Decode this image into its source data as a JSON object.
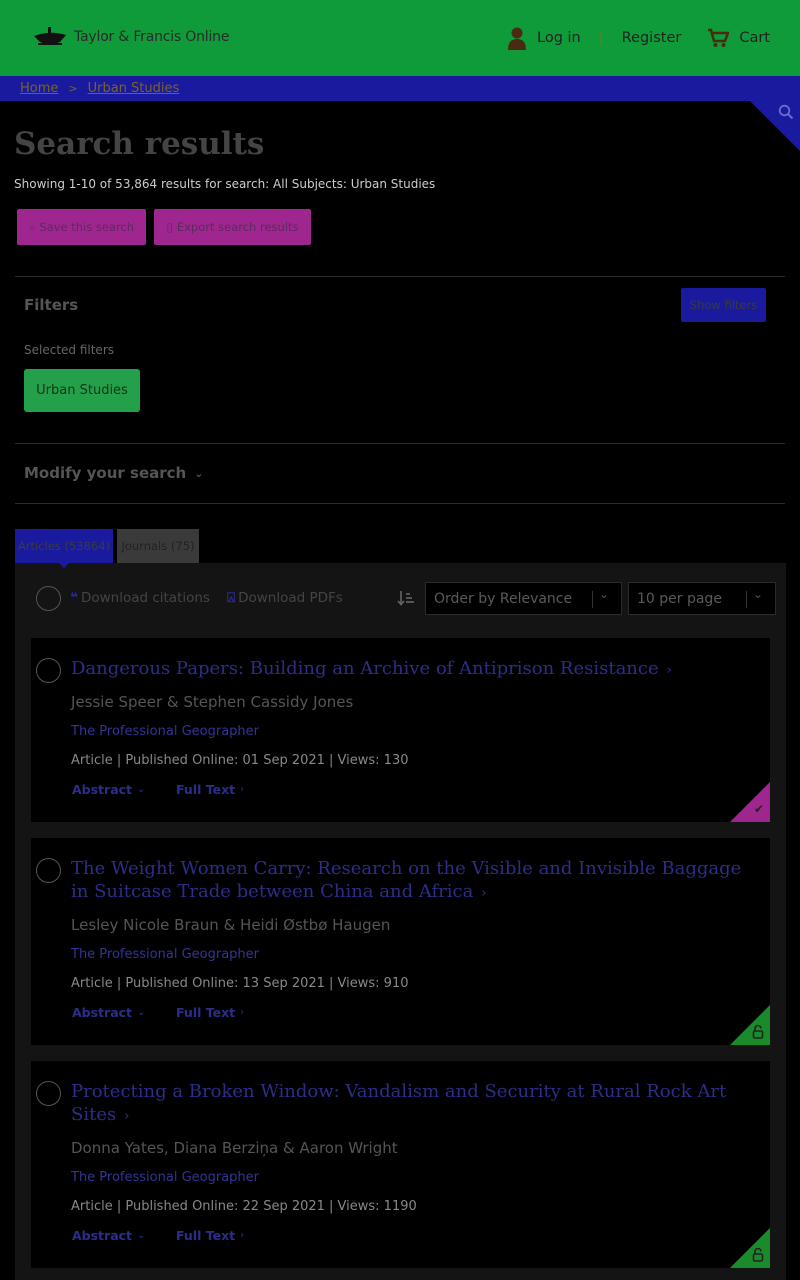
{
  "colors": {
    "header_bg": "#0f9b3a",
    "breadcrumb_bg": "#1a1a9e",
    "magenta_button": "#a0268f",
    "chip_green": "#24a04a",
    "access_free": "#a0268f",
    "access_open": "#1a8a2a"
  },
  "header": {
    "logo_text": "Taylor & Francis Online",
    "login": "Log in",
    "register": "Register",
    "cart": "Cart",
    "separator": "|"
  },
  "breadcrumb": {
    "home": "Home",
    "current": "Urban Studies",
    "separator": ">"
  },
  "page": {
    "title": "Search results",
    "showing": "Showing 1-10 of 53,864 results for search: All Subjects: Urban Studies",
    "save_search": "Save this search",
    "export_results": "Export search results"
  },
  "filters": {
    "title": "Filters",
    "show_button": "Show filters",
    "selected_label": "Selected filters",
    "chip": "Urban Studies",
    "modify": "Modify your search"
  },
  "tabs": [
    {
      "label": "Articles (53864)",
      "active": true
    },
    {
      "label": "Journals (75)",
      "active": false
    }
  ],
  "toolbar": {
    "download_citations": "Download citations",
    "download_pdfs": "Download PDFs",
    "order_by": "Order by Relevance",
    "per_page": "10 per page"
  },
  "results": [
    {
      "title": "Dangerous Papers: Building an Archive of Antiprison Resistance",
      "authors": "Jessie Speer & Stephen Cassidy Jones",
      "journal": "The Professional Geographer",
      "meta": "Article | Published Online: 01 Sep 2021 | Views: 130",
      "abstract": "Abstract",
      "full_text": "Full Text",
      "access_icon": "check-icon"
    },
    {
      "title": "The Weight Women Carry: Research on the Visible and Invisible Baggage in Suitcase Trade between China and Africa",
      "authors": "Lesley Nicole Braun & Heidi Østbø Haugen",
      "journal": "The Professional Geographer",
      "meta": "Article | Published Online: 13 Sep 2021 | Views: 910",
      "abstract": "Abstract",
      "full_text": "Full Text",
      "access_icon": "open-lock-icon"
    },
    {
      "title": "Protecting a Broken Window: Vandalism and Security at Rural Rock Art Sites",
      "authors": "Donna Yates, Diana Berziņa & Aaron Wright",
      "journal": "The Professional Geographer",
      "meta": "Article | Published Online: 22 Sep 2021 | Views: 1190",
      "abstract": "Abstract",
      "full_text": "Full Text",
      "access_icon": "open-lock-icon"
    }
  ]
}
